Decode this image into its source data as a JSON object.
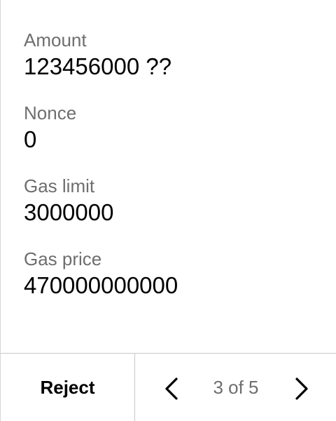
{
  "fields": [
    {
      "label": "Amount",
      "value": "123456000 ??"
    },
    {
      "label": "Nonce",
      "value": "0"
    },
    {
      "label": "Gas limit",
      "value": "3000000"
    },
    {
      "label": "Gas price",
      "value": "470000000000"
    }
  ],
  "footer": {
    "reject_label": "Reject",
    "page_indicator": "3 of 5",
    "prev_icon": "chevron-left-icon",
    "next_icon": "chevron-right-icon"
  },
  "colors": {
    "label": "#6e6e6e",
    "value": "#000000",
    "divider": "#c8c8c8",
    "background": "#ffffff"
  }
}
